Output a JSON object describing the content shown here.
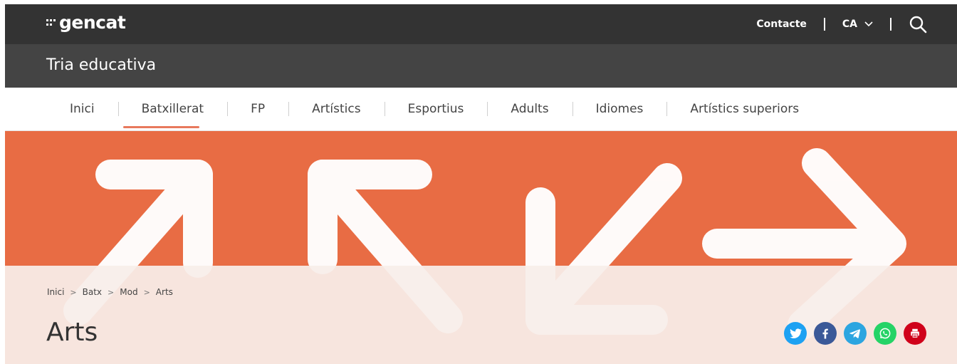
{
  "header": {
    "logo_text": "gencat",
    "contact_label": "Contacte",
    "language": "CA",
    "icons": {
      "search": "search-icon",
      "chevron": "chevron-down-icon"
    }
  },
  "site": {
    "title": "Tria educativa"
  },
  "nav": {
    "items": [
      {
        "label": "Inici"
      },
      {
        "label": "Batxillerat"
      },
      {
        "label": "FP"
      },
      {
        "label": "Artístics"
      },
      {
        "label": "Esportius"
      },
      {
        "label": "Adults"
      },
      {
        "label": "Idiomes"
      },
      {
        "label": "Artístics superiors"
      }
    ],
    "active_index": 1
  },
  "breadcrumb": {
    "items": [
      "Inici",
      "Batx",
      "Mod",
      "Arts"
    ],
    "separator": ">"
  },
  "page": {
    "title": "Arts"
  },
  "share": {
    "buttons": [
      {
        "name": "twitter",
        "icon": "twitter-icon",
        "color": "#1da1f2"
      },
      {
        "name": "facebook",
        "icon": "facebook-icon",
        "color": "#3b5998"
      },
      {
        "name": "telegram",
        "icon": "telegram-icon",
        "color": "#2ca5e0"
      },
      {
        "name": "whatsapp",
        "icon": "whatsapp-icon",
        "color": "#25d366"
      },
      {
        "name": "print",
        "icon": "print-icon",
        "color": "#d0021b"
      }
    ]
  },
  "colors": {
    "topbar": "#333333",
    "subbar": "#444444",
    "hero": "#e86c44",
    "accent": "#e8795d"
  }
}
